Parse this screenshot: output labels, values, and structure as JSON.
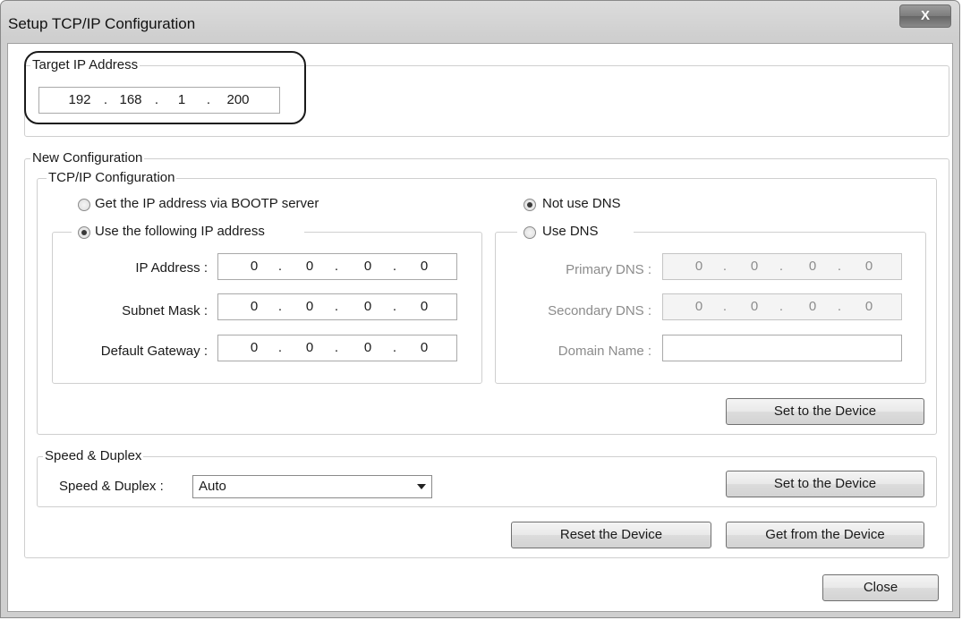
{
  "window": {
    "title": "Setup TCP/IP Configuration",
    "close_glyph": "X"
  },
  "target": {
    "legend": "Target IP Address",
    "ip": [
      "192",
      "168",
      "1",
      "200"
    ]
  },
  "new_config": {
    "legend": "New Configuration",
    "tcpip": {
      "legend": "TCP/IP Configuration",
      "bootp_label": "Get the IP address via BOOTP server",
      "bootp_checked": false,
      "static_label": "Use the following IP address",
      "static_checked": true,
      "ip_address_label": "IP Address :",
      "ip_address": [
        "0",
        "0",
        "0",
        "0"
      ],
      "subnet_label": "Subnet Mask :",
      "subnet": [
        "0",
        "0",
        "0",
        "0"
      ],
      "gateway_label": "Default Gateway :",
      "gateway": [
        "0",
        "0",
        "0",
        "0"
      ],
      "no_dns_label": "Not use DNS",
      "no_dns_checked": true,
      "use_dns_label": "Use DNS",
      "use_dns_checked": false,
      "primary_dns_label": "Primary DNS :",
      "primary_dns": [
        "0",
        "0",
        "0",
        "0"
      ],
      "secondary_dns_label": "Secondary DNS :",
      "secondary_dns": [
        "0",
        "0",
        "0",
        "0"
      ],
      "domain_label": "Domain Name :",
      "domain_value": "",
      "set_button": "Set to the Device"
    },
    "speed": {
      "legend": "Speed & Duplex",
      "label": "Speed & Duplex :",
      "selected": "Auto",
      "set_button": "Set to the Device"
    },
    "reset_button": "Reset the Device",
    "get_button": "Get from the Device"
  },
  "footer": {
    "close_button": "Close"
  },
  "colors": {
    "title_bg": "#d4d4d4",
    "disabled_text": "#8c8c8c",
    "highlight": "#1a1a1a"
  }
}
